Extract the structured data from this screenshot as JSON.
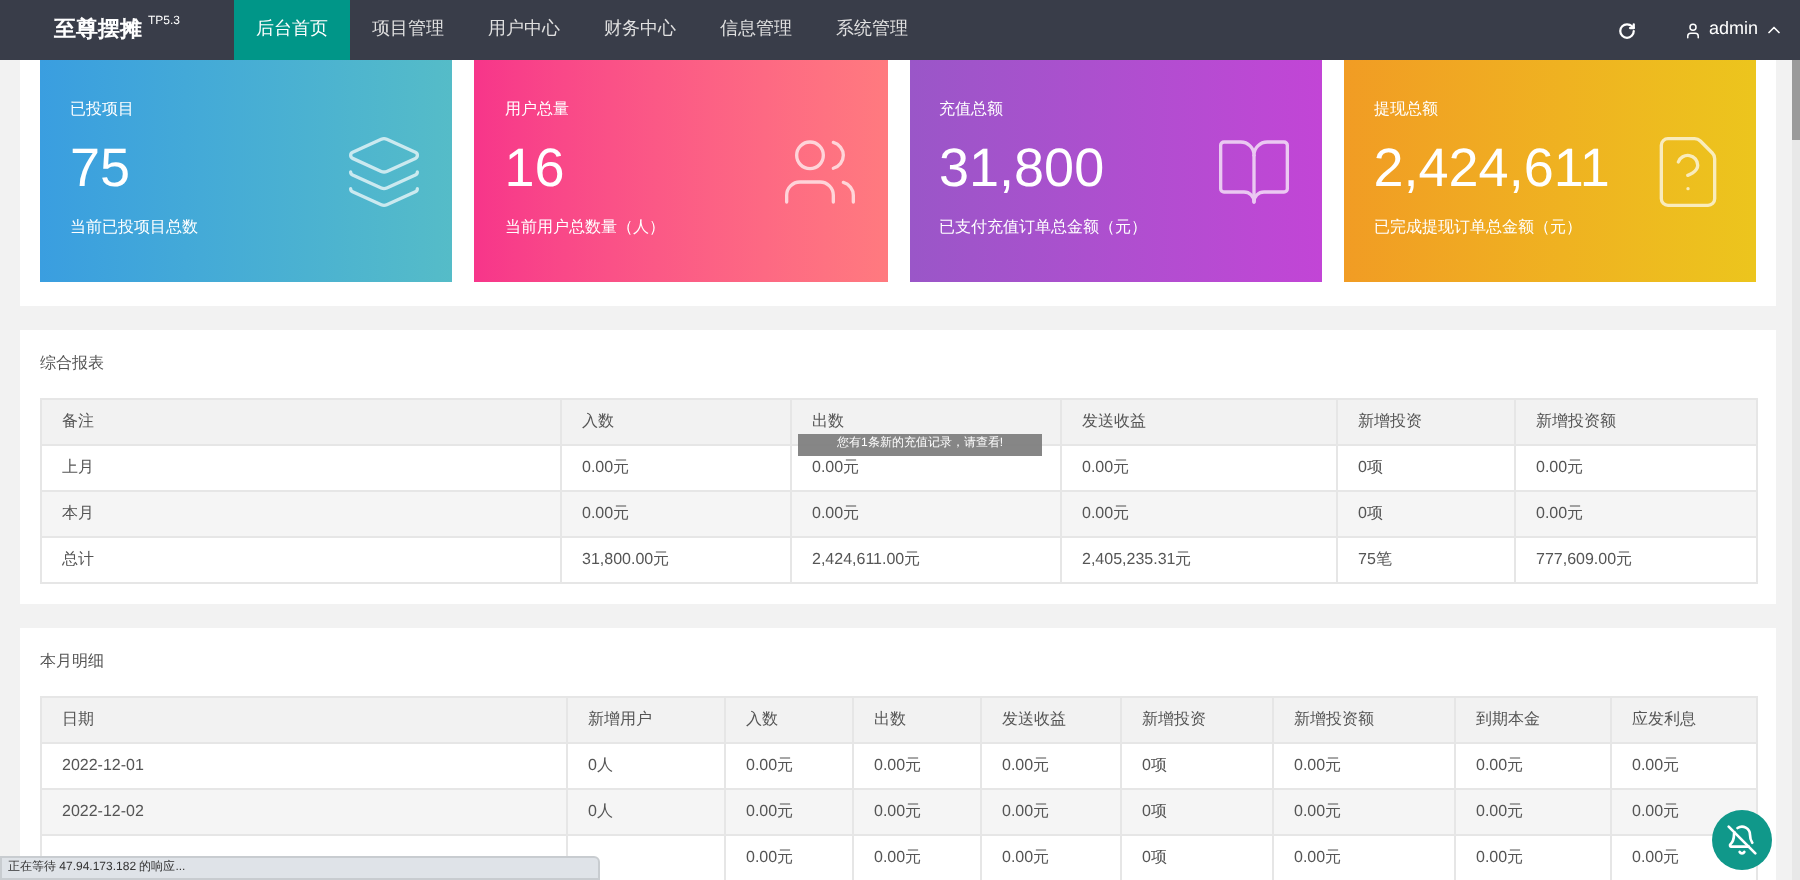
{
  "navbar": {
    "logo": "至尊摆摊",
    "version": "TP5.3",
    "menu": [
      {
        "label": "后台首页",
        "selected": true
      },
      {
        "label": "项目管理",
        "selected": false
      },
      {
        "label": "用户中心",
        "selected": false
      },
      {
        "label": "财务中心",
        "selected": false
      },
      {
        "label": "信息管理",
        "selected": false
      },
      {
        "label": "系统管理",
        "selected": false
      }
    ],
    "user": "admin"
  },
  "cards": [
    {
      "kind": "layers",
      "title": "已投项目",
      "value": "75",
      "note": "当前已投项目总数"
    },
    {
      "kind": "users",
      "title": "用户总量",
      "value": "16",
      "note": "当前用户总数量（人）"
    },
    {
      "kind": "book",
      "title": "充值总额",
      "value": "31,800",
      "note": "已支付充值订单总金额（元）"
    },
    {
      "kind": "question",
      "title": "提现总额",
      "value": "2,424,611",
      "note": "已完成提现订单总金额（元）"
    }
  ],
  "report": {
    "title": "综合报表",
    "columns": [
      "备注",
      "入数",
      "出数",
      "发送收益",
      "新增投资",
      "新增投资额"
    ],
    "rows": [
      [
        "上月",
        "0.00元",
        "0.00元",
        "0.00元",
        "0项",
        "0.00元"
      ],
      [
        "本月",
        "0.00元",
        "0.00元",
        "0.00元",
        "0项",
        "0.00元"
      ],
      [
        "总计",
        "31,800.00元",
        "2,424,611.00元",
        "2,405,235.31元",
        "75笔",
        "777,609.00元"
      ]
    ]
  },
  "toast": "您有1条新的充值记录，请查看!",
  "monthly": {
    "title": "本月明细",
    "columns": [
      "日期",
      "新增用户",
      "入数",
      "出数",
      "发送收益",
      "新增投资",
      "新增投资额",
      "到期本金",
      "应发利息"
    ],
    "rows": [
      [
        "2022-12-01",
        "0人",
        "0.00元",
        "0.00元",
        "0.00元",
        "0项",
        "0.00元",
        "0.00元",
        "0.00元"
      ],
      [
        "2022-12-02",
        "0人",
        "0.00元",
        "0.00元",
        "0.00元",
        "0项",
        "0.00元",
        "0.00元",
        "0.00元"
      ],
      [
        null,
        null,
        "0.00元",
        "0.00元",
        "0.00元",
        "0项",
        "0.00元",
        "0.00元",
        "0.00元"
      ]
    ]
  },
  "status_bar": "正在等待 47.94.173.182 的响应..."
}
